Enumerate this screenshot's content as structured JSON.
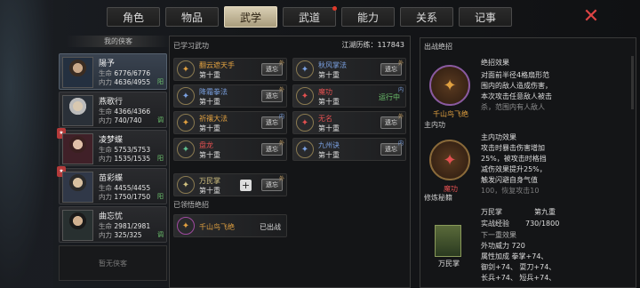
{
  "tabs": [
    {
      "label": "角色"
    },
    {
      "label": "物品"
    },
    {
      "label": "武学"
    },
    {
      "label": "武道"
    },
    {
      "label": "能力"
    },
    {
      "label": "关系"
    },
    {
      "label": "记事"
    }
  ],
  "close_label": "✕",
  "side_title": "我的侠客",
  "heroes": [
    {
      "name": "陽予",
      "hp_label": "生命",
      "hp": "6776/6776",
      "mp_label": "内力",
      "mp": "4636/4955",
      "tag": "阳"
    },
    {
      "name": "燕歌行",
      "hp_label": "生命",
      "hp": "4366/4366",
      "mp_label": "内力",
      "mp": "740/740",
      "tag": "调"
    },
    {
      "name": "凌梦蝶",
      "hp_label": "生命",
      "hp": "5753/5753",
      "mp_label": "内力",
      "mp": "1535/1535",
      "tag": "阳"
    },
    {
      "name": "苗彩蝶",
      "hp_label": "生命",
      "hp": "4455/4455",
      "mp_label": "内力",
      "mp": "1750/1750",
      "tag": "阳"
    },
    {
      "name": "曲忘忧",
      "hp_label": "生命",
      "hp": "2981/2981",
      "mp_label": "内力",
      "mp": "325/325",
      "tag": "调"
    }
  ],
  "empty_label": "暂无侠客",
  "learned_title": "已学习武功",
  "history": "江湖历练：117843",
  "skills": [
    {
      "name": "翻云遮天手",
      "level": "第十重",
      "btn": "遗忘",
      "cat": "外",
      "color": "#e0a040"
    },
    {
      "name": "秋风掌法",
      "level": "第十重",
      "btn": "遗忘",
      "cat": "外",
      "color": "#7aa0e0"
    },
    {
      "name": "降霜拳法",
      "level": "第十重",
      "btn": "遗忘",
      "cat": "外",
      "color": "#7aa0e0"
    },
    {
      "name": "魔功",
      "level": "第十重",
      "btn": "运行中",
      "cat": "内",
      "color": "#e05050"
    },
    {
      "name": "祈禳大法",
      "level": "第十重",
      "btn": "遗忘",
      "cat": "内",
      "color": "#e0a040"
    },
    {
      "name": "无名",
      "level": "第十重",
      "btn": "遗忘",
      "cat": "外",
      "color": "#e05050"
    },
    {
      "name": "盘龙",
      "level": "第十重",
      "btn": "遗忘",
      "cat": "外",
      "color": "#e05050"
    },
    {
      "name": "九州诀",
      "level": "第十重",
      "btn": "遗忘",
      "cat": "内",
      "color": "#7aa0e0"
    },
    {
      "name": "万民掌",
      "level": "第十重",
      "btn": "遗忘",
      "cat": "外",
      "color": "#d0c080"
    }
  ],
  "ultimate_title": "已领悟绝招",
  "ultimate": {
    "name": "千山鸟飞绝",
    "state": "已出战"
  },
  "right": {
    "battle_title": "出战绝招",
    "battle_name": "千山鸟飞绝",
    "battle_desc": [
      "绝招效果",
      "对面前半径4格扇形范",
      "围内的敌人造成伤害，",
      "本次攻击任意敌人被击",
      "杀，范围内有人敌人"
    ],
    "inner_title": "主内功",
    "inner_name": "魔功",
    "inner_desc": [
      "主内功效果",
      "攻击时暴击伤害增加",
      "25%，被攻击时格挡",
      "减伤效果提升25%，",
      "触发闪避自身气值",
      "100，恢复攻击10"
    ],
    "book_title": "修炼秘籍",
    "book_name": "万民掌",
    "book_level": "第九重",
    "exp_label": "实战经验",
    "exp": "730/1800",
    "next_label": "下一重效果",
    "next_lines": [
      "外功威力 720",
      "属性加成    拳掌+74、",
      "御剑+74、  耍刀+74、",
      "长兵+74、  短兵+74、"
    ]
  }
}
